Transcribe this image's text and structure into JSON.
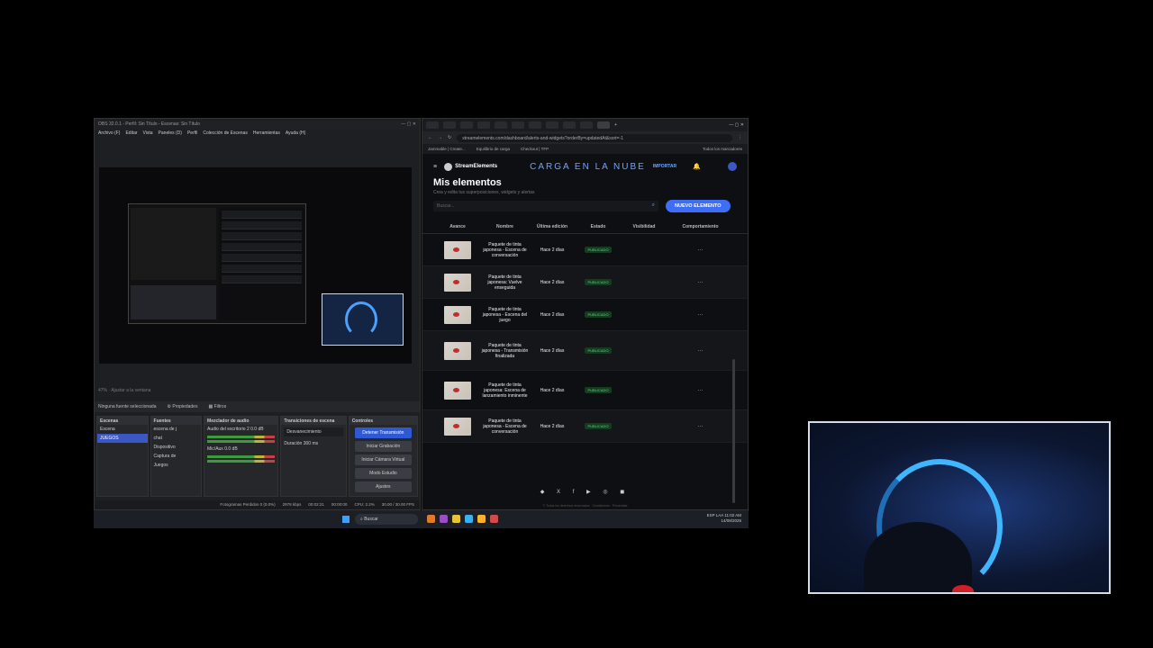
{
  "obs": {
    "title": "OBS 32.0.1 - Perfil: Sin Título - Escenas: Sin Título",
    "menu": [
      "Archivo (F)",
      "Editar",
      "Vista",
      "Paneles (D)",
      "Perfil",
      "Colección de Escenas",
      "Herramientas",
      "Ayuda (H)"
    ],
    "zoom": "47%",
    "fit_label": "Ajustar a la ventana",
    "no_source": "Ninguna fuente seleccionada",
    "properties": "Propiedades",
    "filters": "Filtros",
    "docks": {
      "scenes": {
        "title": "Escenas",
        "items": [
          "Escena",
          "JUEGOS"
        ],
        "selected": 1
      },
      "sources": {
        "title": "Fuentes",
        "items": [
          "escena de j",
          "chat",
          "Dispositivo",
          "Captura de",
          "Juegos"
        ]
      },
      "mixer": {
        "title": "Mezclador de audio",
        "ch1": "Audio del escritorio 2",
        "ch1_db": "0.0 dB",
        "ch2": "Mic/Aux",
        "ch2_db": "0.0 dB"
      },
      "transitions": {
        "title": "Transiciones de escena",
        "type": "Desvanecimiento",
        "duration_label": "Duración",
        "duration": "300 ms"
      },
      "controls": {
        "title": "Controles",
        "stop_stream": "Detener Transmisión",
        "start_rec": "Iniciar Grabación",
        "virtual_cam": "Iniciar Cámara Virtual",
        "studio": "Modo Estudio",
        "settings": "Ajustes"
      }
    },
    "footer": {
      "frames": "Fotogramas Perdidos 0 (0.0%)",
      "bitrate": "2978 kbps",
      "time1": "00:02:21",
      "time2": "00:00:00",
      "cpu": "CPU: 2.2%",
      "fps": "30.00 / 30.00 FPS"
    }
  },
  "taskbar": {
    "search": "Buscar",
    "lang": "ESP LAA",
    "time": "11:02 AM",
    "date": "14/08/2025"
  },
  "browser": {
    "url": "streamelements.com/dashboard/alerts-and-widgets?orderBy=updatedAt&sort=-1",
    "bookmarks": [
      "Jammable | Create...",
      "Equilibrio de carga",
      "Checkout | TFP"
    ],
    "bookmarks_right": "Todos los marcadores",
    "brand": "StreamElements",
    "banner": "CARGA EN LA NUBE",
    "import": "IMPORTAR",
    "page_title": "Mis elementos",
    "page_subtitle": "Crea y edita tus superposiciones, widgets y alertas",
    "search_placeholder": "Buscar...",
    "new_button": "NUEVO ELEMENTO",
    "columns": [
      "Avance",
      "Nombre",
      "Última edición",
      "Estado",
      "Visibilidad",
      "Comportamiento"
    ],
    "rows": [
      {
        "name": "Paquete de tinta japonesa - Escena de conversación",
        "edited": "Hace 2 días",
        "status": "PUBLICADO"
      },
      {
        "name": "Paquete de tinta japonesa: Vuelve enseguida",
        "edited": "Hace 2 días",
        "status": "PUBLICADO"
      },
      {
        "name": "Paquete de tinta japonesa - Escena del juego",
        "edited": "Hace 2 días",
        "status": "PUBLICADO"
      },
      {
        "name": "Paquete de tinta japonesa - Transmisión finalizada",
        "edited": "Hace 2 días",
        "status": "PUBLICADO"
      },
      {
        "name": "Paquete de tinta japonesa: Escena de lanzamiento inminente",
        "edited": "Hace 2 días",
        "status": "PUBLICADO"
      },
      {
        "name": "Paquete de tinta japonesa - Escena de conversación",
        "edited": "Hace 2 días",
        "status": "PUBLICADO"
      }
    ],
    "footer_icons": "◆ X f ▶ ◎ ◼",
    "copyright": "© Todos los derechos reservados · Condiciones · Privacidad"
  }
}
